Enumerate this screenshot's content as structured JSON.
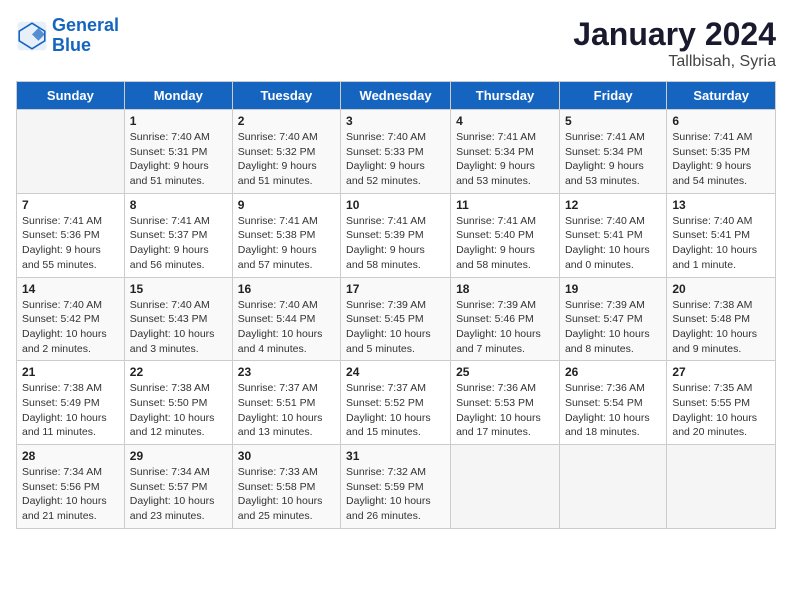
{
  "header": {
    "logo_line1": "General",
    "logo_line2": "Blue",
    "month": "January 2024",
    "location": "Tallbisah, Syria"
  },
  "columns": [
    "Sunday",
    "Monday",
    "Tuesday",
    "Wednesday",
    "Thursday",
    "Friday",
    "Saturday"
  ],
  "weeks": [
    [
      {
        "day": "",
        "info": ""
      },
      {
        "day": "1",
        "info": "Sunrise: 7:40 AM\nSunset: 5:31 PM\nDaylight: 9 hours\nand 51 minutes."
      },
      {
        "day": "2",
        "info": "Sunrise: 7:40 AM\nSunset: 5:32 PM\nDaylight: 9 hours\nand 51 minutes."
      },
      {
        "day": "3",
        "info": "Sunrise: 7:40 AM\nSunset: 5:33 PM\nDaylight: 9 hours\nand 52 minutes."
      },
      {
        "day": "4",
        "info": "Sunrise: 7:41 AM\nSunset: 5:34 PM\nDaylight: 9 hours\nand 53 minutes."
      },
      {
        "day": "5",
        "info": "Sunrise: 7:41 AM\nSunset: 5:34 PM\nDaylight: 9 hours\nand 53 minutes."
      },
      {
        "day": "6",
        "info": "Sunrise: 7:41 AM\nSunset: 5:35 PM\nDaylight: 9 hours\nand 54 minutes."
      }
    ],
    [
      {
        "day": "7",
        "info": "Sunrise: 7:41 AM\nSunset: 5:36 PM\nDaylight: 9 hours\nand 55 minutes."
      },
      {
        "day": "8",
        "info": "Sunrise: 7:41 AM\nSunset: 5:37 PM\nDaylight: 9 hours\nand 56 minutes."
      },
      {
        "day": "9",
        "info": "Sunrise: 7:41 AM\nSunset: 5:38 PM\nDaylight: 9 hours\nand 57 minutes."
      },
      {
        "day": "10",
        "info": "Sunrise: 7:41 AM\nSunset: 5:39 PM\nDaylight: 9 hours\nand 58 minutes."
      },
      {
        "day": "11",
        "info": "Sunrise: 7:41 AM\nSunset: 5:40 PM\nDaylight: 9 hours\nand 58 minutes."
      },
      {
        "day": "12",
        "info": "Sunrise: 7:40 AM\nSunset: 5:41 PM\nDaylight: 10 hours\nand 0 minutes."
      },
      {
        "day": "13",
        "info": "Sunrise: 7:40 AM\nSunset: 5:41 PM\nDaylight: 10 hours\nand 1 minute."
      }
    ],
    [
      {
        "day": "14",
        "info": "Sunrise: 7:40 AM\nSunset: 5:42 PM\nDaylight: 10 hours\nand 2 minutes."
      },
      {
        "day": "15",
        "info": "Sunrise: 7:40 AM\nSunset: 5:43 PM\nDaylight: 10 hours\nand 3 minutes."
      },
      {
        "day": "16",
        "info": "Sunrise: 7:40 AM\nSunset: 5:44 PM\nDaylight: 10 hours\nand 4 minutes."
      },
      {
        "day": "17",
        "info": "Sunrise: 7:39 AM\nSunset: 5:45 PM\nDaylight: 10 hours\nand 5 minutes."
      },
      {
        "day": "18",
        "info": "Sunrise: 7:39 AM\nSunset: 5:46 PM\nDaylight: 10 hours\nand 7 minutes."
      },
      {
        "day": "19",
        "info": "Sunrise: 7:39 AM\nSunset: 5:47 PM\nDaylight: 10 hours\nand 8 minutes."
      },
      {
        "day": "20",
        "info": "Sunrise: 7:38 AM\nSunset: 5:48 PM\nDaylight: 10 hours\nand 9 minutes."
      }
    ],
    [
      {
        "day": "21",
        "info": "Sunrise: 7:38 AM\nSunset: 5:49 PM\nDaylight: 10 hours\nand 11 minutes."
      },
      {
        "day": "22",
        "info": "Sunrise: 7:38 AM\nSunset: 5:50 PM\nDaylight: 10 hours\nand 12 minutes."
      },
      {
        "day": "23",
        "info": "Sunrise: 7:37 AM\nSunset: 5:51 PM\nDaylight: 10 hours\nand 13 minutes."
      },
      {
        "day": "24",
        "info": "Sunrise: 7:37 AM\nSunset: 5:52 PM\nDaylight: 10 hours\nand 15 minutes."
      },
      {
        "day": "25",
        "info": "Sunrise: 7:36 AM\nSunset: 5:53 PM\nDaylight: 10 hours\nand 17 minutes."
      },
      {
        "day": "26",
        "info": "Sunrise: 7:36 AM\nSunset: 5:54 PM\nDaylight: 10 hours\nand 18 minutes."
      },
      {
        "day": "27",
        "info": "Sunrise: 7:35 AM\nSunset: 5:55 PM\nDaylight: 10 hours\nand 20 minutes."
      }
    ],
    [
      {
        "day": "28",
        "info": "Sunrise: 7:34 AM\nSunset: 5:56 PM\nDaylight: 10 hours\nand 21 minutes."
      },
      {
        "day": "29",
        "info": "Sunrise: 7:34 AM\nSunset: 5:57 PM\nDaylight: 10 hours\nand 23 minutes."
      },
      {
        "day": "30",
        "info": "Sunrise: 7:33 AM\nSunset: 5:58 PM\nDaylight: 10 hours\nand 25 minutes."
      },
      {
        "day": "31",
        "info": "Sunrise: 7:32 AM\nSunset: 5:59 PM\nDaylight: 10 hours\nand 26 minutes."
      },
      {
        "day": "",
        "info": ""
      },
      {
        "day": "",
        "info": ""
      },
      {
        "day": "",
        "info": ""
      }
    ]
  ]
}
